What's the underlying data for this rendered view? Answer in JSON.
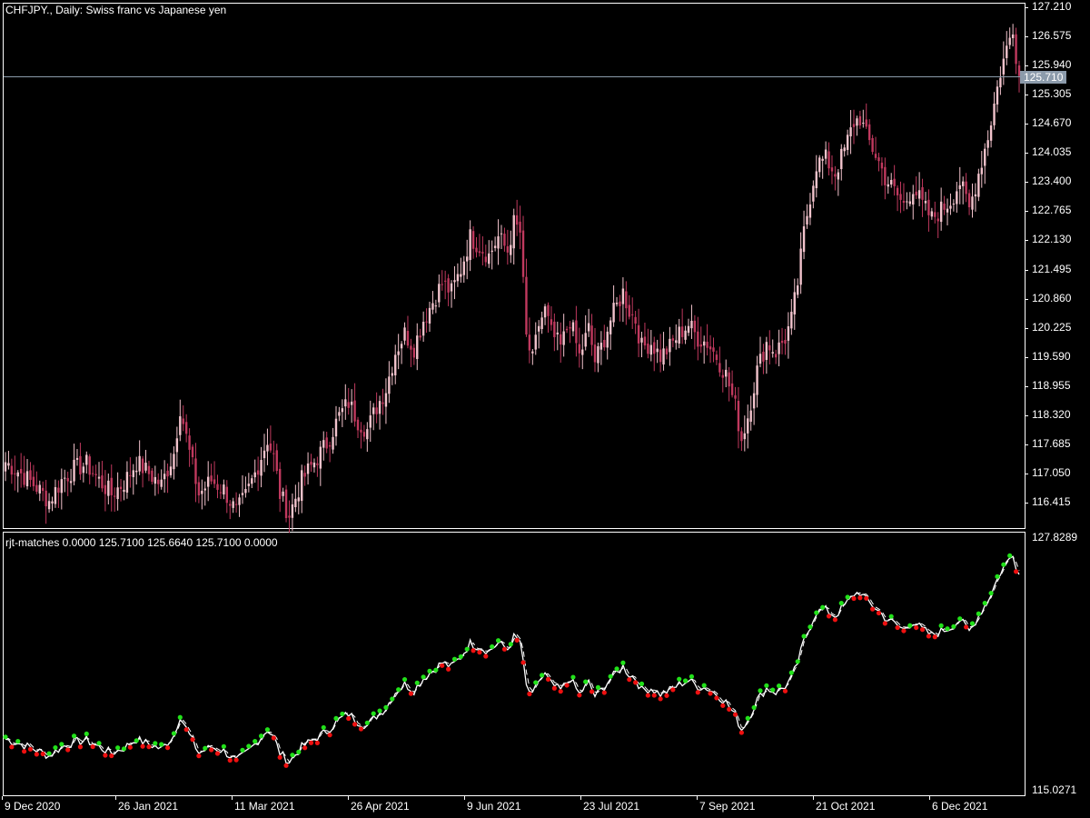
{
  "main_title": "CHFJPY., Daily:  Swiss franc vs Japanese yen",
  "indicator_title": "rjt-matches 0.0000 125.7100 125.6640 125.7100 0.0000",
  "current_price_label": "125.710",
  "colors": {
    "background": "#000000",
    "frame": "#ffffff",
    "candle_up": "#f2c3cc",
    "candle_down": "#c0395e",
    "price_line": "#8c9bab",
    "indicator_line": "#ffffff",
    "dot_up": "#22e11a",
    "dot_down": "#ee1010"
  },
  "chart_data": [
    {
      "type": "candlestick",
      "title": "CHFJPY., Daily:  Swiss franc vs Japanese yen",
      "y_ticks": [
        "127.210",
        "126.575",
        "125.940",
        "125.305",
        "124.670",
        "124.035",
        "123.400",
        "122.765",
        "122.130",
        "121.495",
        "120.860",
        "120.225",
        "119.590",
        "118.955",
        "118.320",
        "117.685",
        "117.050",
        "116.415"
      ],
      "x_ticks": [
        "9 Dec 2020",
        "26 Jan 2021",
        "11 Mar 2021",
        "26 Apr 2021",
        "9 Jun 2021",
        "23 Jul 2021",
        "7 Sep 2021",
        "21 Oct 2021",
        "6 Dec 2021"
      ],
      "ylim": [
        115.9,
        127.3
      ],
      "current_price": 125.71,
      "close_anchors": [
        [
          0,
          117.3
        ],
        [
          5,
          117.05
        ],
        [
          10,
          116.75
        ],
        [
          14,
          116.45
        ],
        [
          18,
          116.9
        ],
        [
          22,
          117.15
        ],
        [
          26,
          117.25
        ],
        [
          30,
          116.9
        ],
        [
          34,
          116.6
        ],
        [
          38,
          116.85
        ],
        [
          42,
          117.3
        ],
        [
          46,
          117.05
        ],
        [
          50,
          116.8
        ],
        [
          54,
          117.5
        ],
        [
          56,
          118.5
        ],
        [
          59,
          117.5
        ],
        [
          62,
          116.6
        ],
        [
          66,
          116.9
        ],
        [
          70,
          116.7
        ],
        [
          74,
          116.2
        ],
        [
          77,
          116.55
        ],
        [
          80,
          117.05
        ],
        [
          84,
          117.8
        ],
        [
          86,
          117.4
        ],
        [
          88,
          116.6
        ],
        [
          91,
          116.15
        ],
        [
          95,
          116.9
        ],
        [
          99,
          117.3
        ],
        [
          103,
          117.7
        ],
        [
          107,
          118.3
        ],
        [
          110,
          118.6
        ],
        [
          113,
          118.2
        ],
        [
          116,
          118.0
        ],
        [
          119,
          118.5
        ],
        [
          122,
          118.9
        ],
        [
          125,
          119.7
        ],
        [
          128,
          120.1
        ],
        [
          131,
          119.8
        ],
        [
          134,
          120.4
        ],
        [
          137,
          120.8
        ],
        [
          140,
          121.2
        ],
        [
          143,
          121.0
        ],
        [
          146,
          121.5
        ],
        [
          149,
          122.2
        ],
        [
          152,
          122.0
        ],
        [
          155,
          121.8
        ],
        [
          158,
          122.2
        ],
        [
          161,
          121.9
        ],
        [
          163,
          122.5
        ],
        [
          165,
          122.3
        ],
        [
          167,
          120.0
        ],
        [
          169,
          119.5
        ],
        [
          171,
          120.3
        ],
        [
          173,
          120.6
        ],
        [
          175,
          120.1
        ],
        [
          178,
          119.8
        ],
        [
          181,
          120.4
        ],
        [
          184,
          119.6
        ],
        [
          187,
          120.2
        ],
        [
          189,
          119.5
        ],
        [
          191,
          119.8
        ],
        [
          194,
          120.4
        ],
        [
          196,
          120.7
        ],
        [
          198,
          121.0
        ],
        [
          200,
          120.6
        ],
        [
          202,
          120.4
        ],
        [
          204,
          119.8
        ],
        [
          207,
          119.9
        ],
        [
          210,
          119.6
        ],
        [
          213,
          119.8
        ],
        [
          216,
          120.1
        ],
        [
          219,
          120.3
        ],
        [
          222,
          120.0
        ],
        [
          225,
          119.9
        ],
        [
          228,
          119.6
        ],
        [
          231,
          119.2
        ],
        [
          234,
          118.5
        ],
        [
          236,
          117.8
        ],
        [
          238,
          118.3
        ],
        [
          241,
          119.3
        ],
        [
          244,
          119.9
        ],
        [
          247,
          119.7
        ],
        [
          250,
          120.0
        ],
        [
          252,
          120.4
        ],
        [
          254,
          121.2
        ],
        [
          256,
          122.3
        ],
        [
          258,
          123.1
        ],
        [
          260,
          123.8
        ],
        [
          263,
          123.9
        ],
        [
          266,
          123.6
        ],
        [
          269,
          124.1
        ],
        [
          272,
          124.7
        ],
        [
          274,
          124.8
        ],
        [
          276,
          124.4
        ],
        [
          279,
          124.0
        ],
        [
          282,
          123.5
        ],
        [
          285,
          123.2
        ],
        [
          288,
          122.9
        ],
        [
          291,
          123.3
        ],
        [
          294,
          122.9
        ],
        [
          297,
          122.6
        ],
        [
          300,
          122.8
        ],
        [
          303,
          123.0
        ],
        [
          306,
          123.4
        ],
        [
          309,
          122.8
        ],
        [
          312,
          123.6
        ],
        [
          315,
          124.4
        ],
        [
          317,
          125.1
        ],
        [
          319,
          125.8
        ],
        [
          321,
          126.3
        ],
        [
          323,
          126.8
        ],
        [
          324,
          126.2
        ],
        [
          325,
          125.71
        ]
      ]
    },
    {
      "type": "line",
      "title": "rjt-matches 0.0000 125.7100 125.6640 125.7100 0.0000",
      "y_ticks": [
        "127.8289",
        "115.0271"
      ],
      "ylim": [
        115.0271,
        127.8289
      ],
      "series": []
    }
  ]
}
